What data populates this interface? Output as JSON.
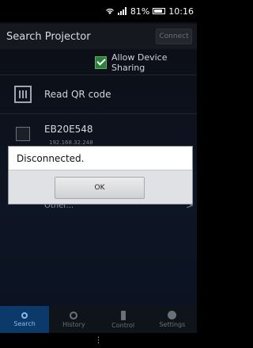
{
  "status_bar": {
    "battery_text": "81%",
    "time": "10:16"
  },
  "header": {
    "title": "Search Projector",
    "connect_label": "Connect"
  },
  "allow_sharing": {
    "label": "Allow Device Sharing",
    "checked": true
  },
  "qr": {
    "label": "Read QR code"
  },
  "projector": {
    "name": "EB20E548",
    "ip": "192.168.32.248"
  },
  "other": {
    "label": "Other..."
  },
  "dialog": {
    "message": "Disconnected.",
    "ok_label": "OK"
  },
  "tabs": [
    {
      "label": "Search",
      "icon": "search-icon"
    },
    {
      "label": "History",
      "icon": "clock-icon"
    },
    {
      "label": "Control",
      "icon": "remote-icon"
    },
    {
      "label": "Settings",
      "icon": "gear-icon"
    }
  ],
  "nav": {
    "menu_glyph": "⋮"
  }
}
